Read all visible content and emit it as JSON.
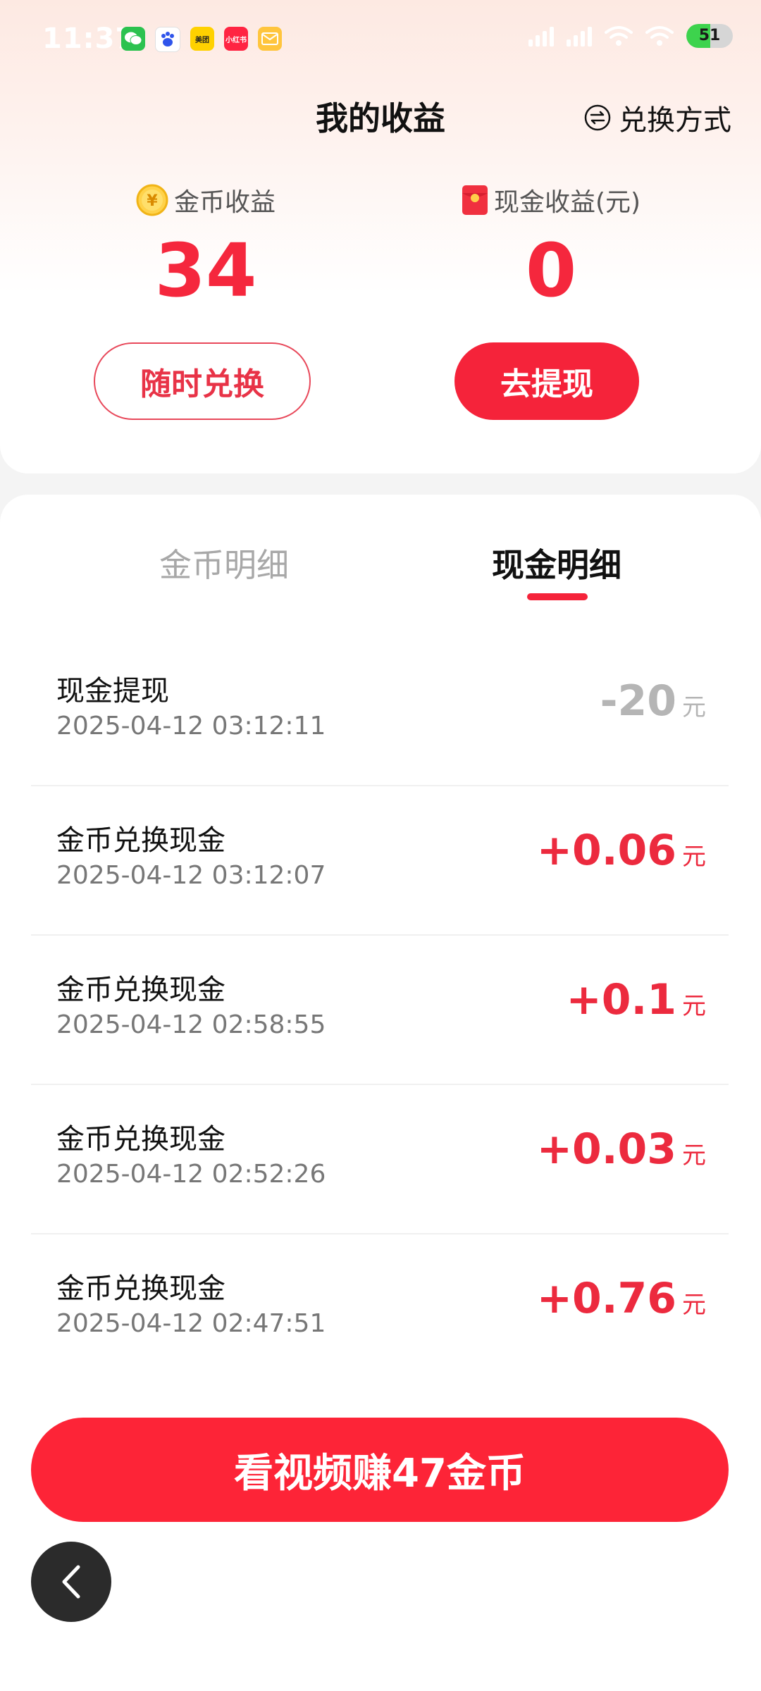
{
  "status_bar": {
    "time": "11:37",
    "battery": "51",
    "battery_level": 0.51,
    "apps": [
      {
        "name": "wechat-icon",
        "glyph": ""
      },
      {
        "name": "baidu-icon",
        "glyph": ""
      },
      {
        "name": "meituan-icon",
        "glyph": "美团"
      },
      {
        "name": "xiaohongshu-icon",
        "glyph": "小红书"
      },
      {
        "name": "mail-icon",
        "glyph": ""
      }
    ]
  },
  "header": {
    "title": "我的收益",
    "exchange_method": "兑换方式"
  },
  "summary": {
    "gold_label": "金币收益",
    "gold_value": "34",
    "cash_label": "现金收益(元)",
    "cash_value": "0",
    "exchange_button": "随时兑换",
    "withdraw_button": "去提现"
  },
  "tabs": {
    "gold": "金币明细",
    "cash": "现金明细",
    "active": "cash"
  },
  "records": [
    {
      "title": "现金提现",
      "time": "2025-04-12 03:12:11",
      "amount": "-20",
      "unit": "元",
      "sign": "neg"
    },
    {
      "title": "金币兑换现金",
      "time": "2025-04-12 03:12:07",
      "amount": "+0.06",
      "unit": "元",
      "sign": "pos"
    },
    {
      "title": "金币兑换现金",
      "time": "2025-04-12 02:58:55",
      "amount": "+0.1",
      "unit": "元",
      "sign": "pos"
    },
    {
      "title": "金币兑换现金",
      "time": "2025-04-12 02:52:26",
      "amount": "+0.03",
      "unit": "元",
      "sign": "pos"
    },
    {
      "title": "金币兑换现金",
      "time": "2025-04-12 02:47:51",
      "amount": "+0.76",
      "unit": "元",
      "sign": "pos"
    }
  ],
  "cta": {
    "label": "看视频赚47金币"
  },
  "colors": {
    "accent": "#f5233a",
    "negative_amount": "#b5b5b5",
    "positive_amount": "#ec2a3e"
  }
}
